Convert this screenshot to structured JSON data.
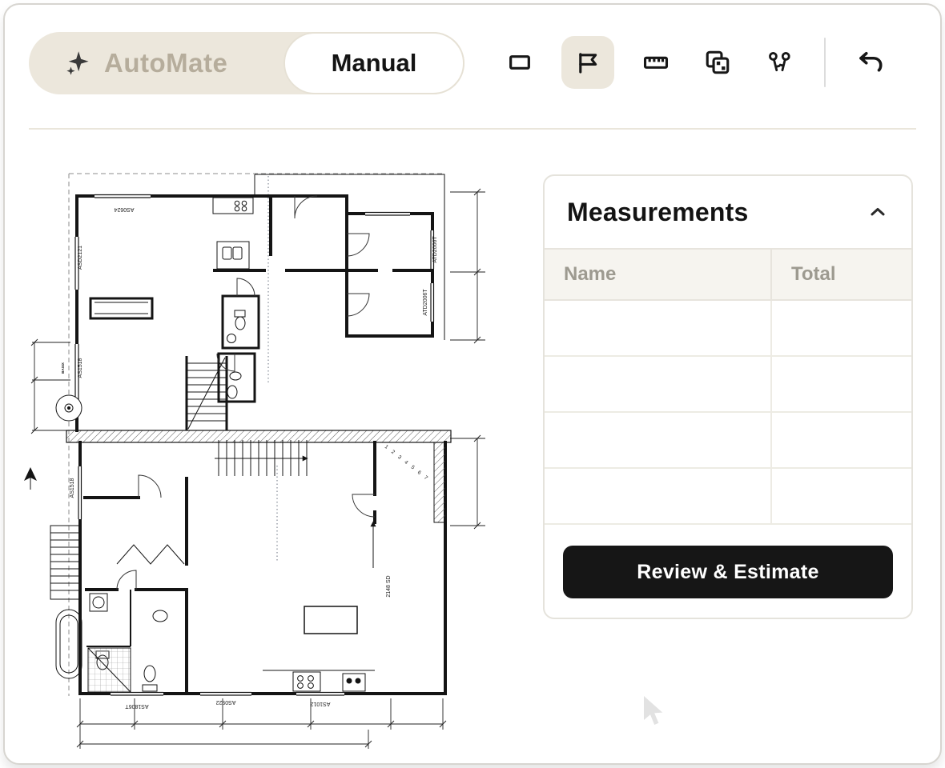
{
  "colors": {
    "accent-beige": "#ece7dc",
    "cta-black": "#161616"
  },
  "header": {
    "mode_automate": "AutoMate",
    "mode_manual": "Manual",
    "icons": [
      "sparkles-icon",
      "rectangle-tool-icon",
      "flag-tool-icon",
      "ruler-tool-icon",
      "duplicate-tool-icon",
      "keys-tool-icon",
      "undo-icon"
    ]
  },
  "measurements": {
    "title": "Measurements",
    "columns": {
      "name": "Name",
      "total": "Total"
    },
    "row_count": 4,
    "cta_label": "Review & Estimate"
  },
  "floorplan": {
    "labels": {
      "as0624": "AS0624",
      "asd2121": "ASD2121",
      "as1518_upper": "AS1518",
      "basix": "BASIX",
      "atd2006t_1": "ATD2006T",
      "atd2006t_2": "ATD2006T",
      "as1518_lower": "AS1518",
      "as1806t": "AS1806T",
      "as0922": "AS0922",
      "as1012": "AS1012",
      "sd_2148": "2148 SD",
      "stair_numbers": "1 2 3 4 5 6 7"
    }
  }
}
